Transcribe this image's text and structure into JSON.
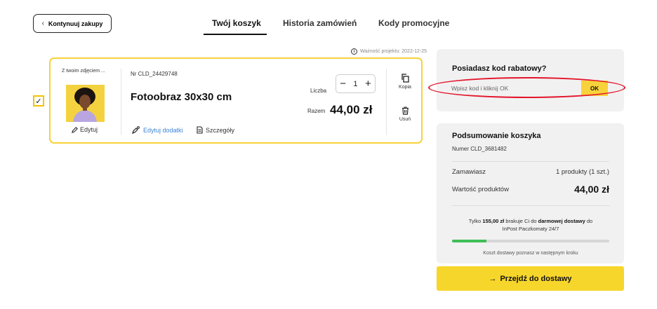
{
  "nav": {
    "back_label": "Kontynuuj zakupy"
  },
  "tabs": [
    {
      "label": "Twój koszyk",
      "active": true
    },
    {
      "label": "Historia zamówień",
      "active": false
    },
    {
      "label": "Kody promocyjne",
      "active": false
    }
  ],
  "project_validity": "Ważność projektu: 2022-12-25",
  "cart_item": {
    "selected": true,
    "thumb_caption": "Z twoim zdjęciem ...",
    "edit_label": "Edytuj",
    "order_number": "Nr CLD_24429748",
    "title": "Fotoobraz 30x30 cm",
    "addons_label": "Edytuj dodatki",
    "details_label": "Szczegóły",
    "quantity_label": "Liczba",
    "quantity": "1",
    "total_label": "Razem",
    "total_value": "44,00 zł",
    "copy_label": "Kopia",
    "delete_label": "Usuń"
  },
  "promo": {
    "title": "Posiadasz kod rabatowy?",
    "placeholder": "Wpisz kod i kliknij OK",
    "ok_label": "OK"
  },
  "summary": {
    "title": "Podsumowanie koszyka",
    "number": "Numer CLD_3681482",
    "order_label": "Zamawiasz",
    "order_value": "1 produkty (1 szt.)",
    "products_value_label": "Wartość produktów",
    "products_value": "44,00 zł",
    "shipping": {
      "prefix": "Tylko",
      "amount": "155,00 zł",
      "middle": "brakuje Ci do",
      "free": "darmowej dostawy",
      "suffix": "do",
      "line2": "InPost Paczkomaty 24/7",
      "progress_fraction": 0.22
    },
    "shipping_note": "Koszt dostawy poznasz w następnym kroku"
  },
  "cta_label": "Przejdź do dostawy",
  "colors": {
    "accent_yellow": "#f7d23a",
    "highlight_red": "#e3142b",
    "progress_green": "#3fbf57"
  }
}
